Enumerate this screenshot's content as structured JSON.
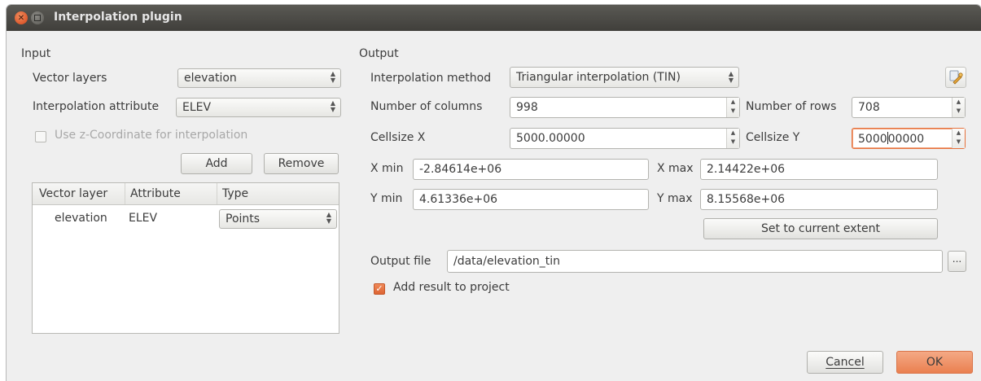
{
  "window": {
    "title": "Interpolation plugin"
  },
  "input": {
    "section_label": "Input",
    "vector_layers_label": "Vector layers",
    "vector_layers_value": "elevation",
    "interp_attr_label": "Interpolation attribute",
    "interp_attr_value": "ELEV",
    "use_z_label": "Use z-Coordinate for interpolation",
    "use_z_checked": false,
    "add_label": "Add",
    "remove_label": "Remove",
    "table": {
      "columns": [
        "Vector layer",
        "Attribute",
        "Type"
      ],
      "rows": [
        {
          "layer": "elevation",
          "attribute": "ELEV",
          "type": "Points"
        }
      ]
    }
  },
  "output": {
    "section_label": "Output",
    "method_label": "Interpolation method",
    "method_value": "Triangular interpolation (TIN)",
    "num_columns_label": "Number of columns",
    "num_columns_value": "998",
    "num_rows_label": "Number of rows",
    "num_rows_value": "708",
    "cellsize_x_label": "Cellsize X",
    "cellsize_x_value": "5000.00000",
    "cellsize_y_label": "Cellsize Y",
    "cellsize_y_before_caret": "5000",
    "cellsize_y_after_caret": "00000",
    "xmin_label": "X min",
    "xmin_value": "-2.84614e+06",
    "xmax_label": "X max",
    "xmax_value": "2.14422e+06",
    "ymin_label": "Y min",
    "ymin_value": "4.61336e+06",
    "ymax_label": "Y max",
    "ymax_value": "8.15568e+06",
    "set_extent_label": "Set to current extent",
    "output_file_label": "Output file",
    "output_file_value": "/data/elevation_tin",
    "browse_label": "...",
    "add_result_label": "Add result to project",
    "add_result_checked": true
  },
  "footer": {
    "cancel_label": "Cancel",
    "ok_label": "OK"
  },
  "icons": {
    "close": "close-icon",
    "minimize": "minimize-icon",
    "settings": "wrench-icon",
    "combo_arrows": "updown-arrows-icon",
    "check": "checkmark-icon"
  },
  "colors": {
    "titlebar": "#403f3b",
    "accent": "#e6723d",
    "ok_button": "#ea8050",
    "window_bg": "#efefef"
  }
}
